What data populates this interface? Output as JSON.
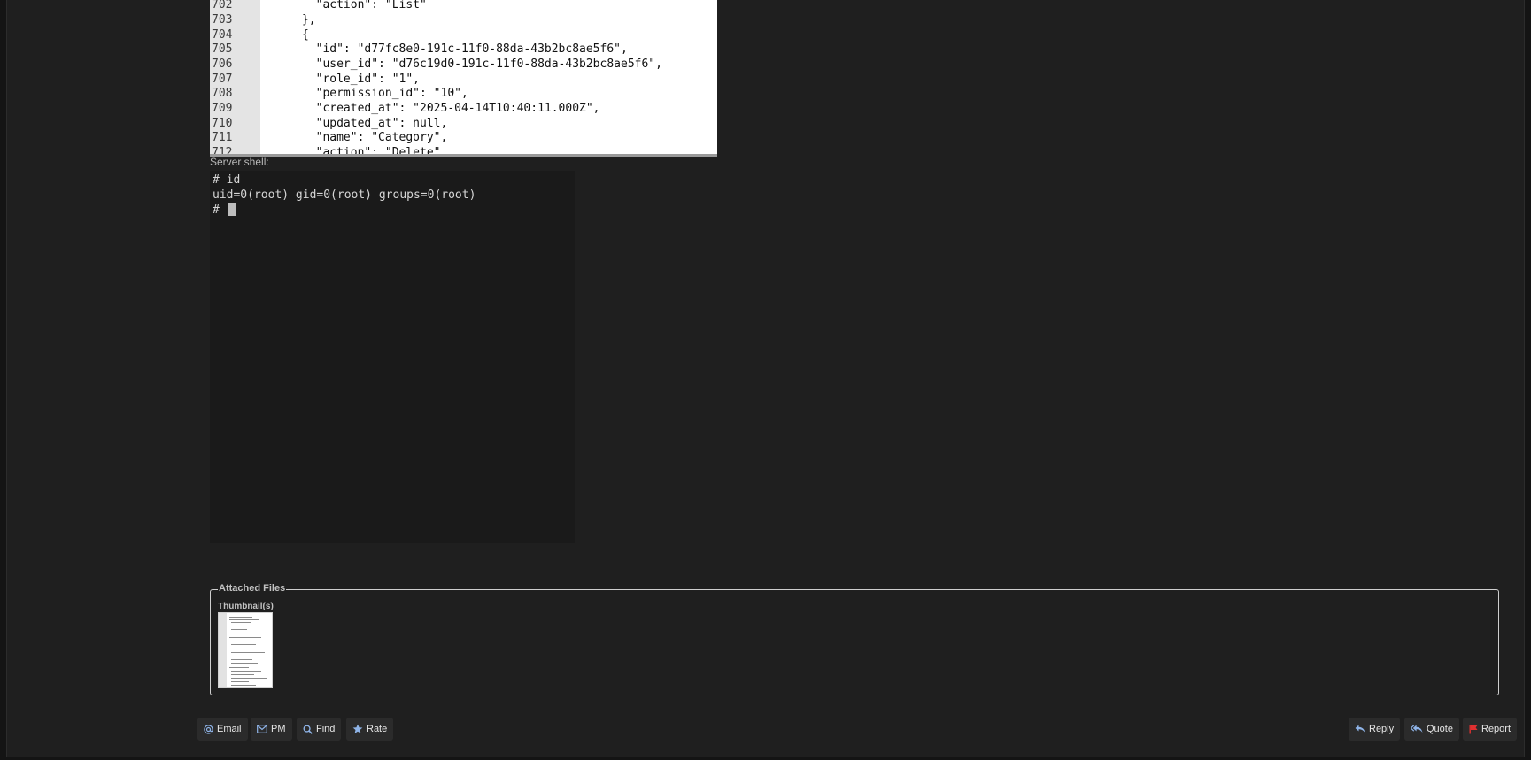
{
  "code_view": {
    "lines": [
      {
        "num": "702",
        "text": "        \"action\": \"List\""
      },
      {
        "num": "703",
        "text": "      },"
      },
      {
        "num": "704",
        "text": "      {"
      },
      {
        "num": "705",
        "text": "        \"id\": \"d77fc8e0-191c-11f0-88da-43b2bc8ae5f6\","
      },
      {
        "num": "706",
        "text": "        \"user_id\": \"d76c19d0-191c-11f0-88da-43b2bc8ae5f6\","
      },
      {
        "num": "707",
        "text": "        \"role_id\": \"1\","
      },
      {
        "num": "708",
        "text": "        \"permission_id\": \"10\","
      },
      {
        "num": "709",
        "text": "        \"created_at\": \"2025-04-14T10:40:11.000Z\","
      },
      {
        "num": "710",
        "text": "        \"updated_at\": null,"
      },
      {
        "num": "711",
        "text": "        \"name\": \"Category\","
      },
      {
        "num": "712",
        "text": "        \"action\": \"Delete\""
      }
    ]
  },
  "shell": {
    "label": "Server shell:",
    "lines": [
      "# id",
      "uid=0(root) gid=0(root) groups=0(root)"
    ],
    "prompt": "# "
  },
  "attachments": {
    "legend": "Attached Files",
    "thumbnails_label": "Thumbnail(s)"
  },
  "actions": {
    "email": {
      "label": "Email",
      "icon": "at-icon"
    },
    "pm": {
      "label": "PM",
      "icon": "envelope-icon"
    },
    "find": {
      "label": "Find",
      "icon": "search-icon"
    },
    "rate": {
      "label": "Rate",
      "icon": "star-icon"
    },
    "reply": {
      "label": "Reply",
      "icon": "reply-icon"
    },
    "quote": {
      "label": "Quote",
      "icon": "reply-all-icon"
    },
    "report": {
      "label": "Report",
      "icon": "flag-icon",
      "icon_color": "#e03030"
    }
  },
  "colors": {
    "background": "#1f1f1f",
    "button_bg": "#2b2b2b",
    "icon_blue": "#8fb4e8"
  }
}
